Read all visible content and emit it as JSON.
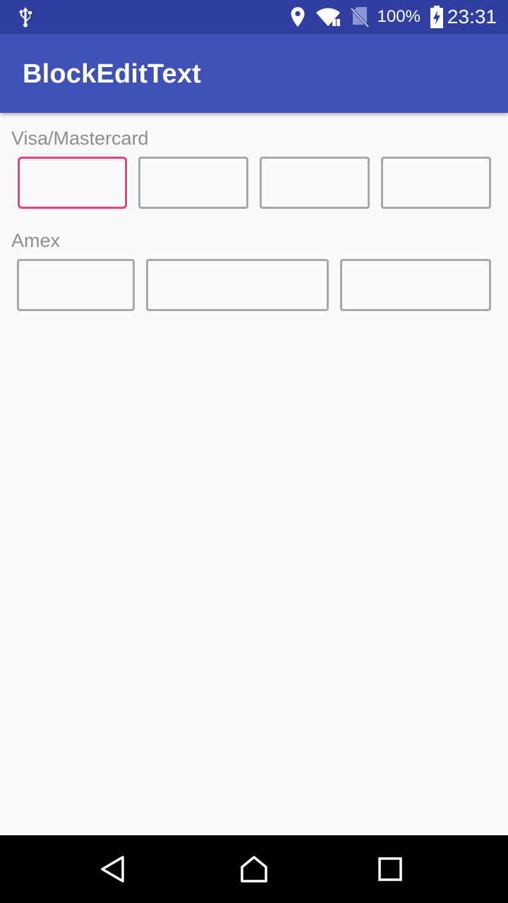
{
  "status_bar": {
    "icons": [
      "usb-icon",
      "location-icon",
      "wifi-icon",
      "no-sim-icon",
      "battery-charging-icon"
    ],
    "battery": "100%",
    "time": "23:31"
  },
  "app_bar": {
    "title": "BlockEditText"
  },
  "sections": [
    {
      "label": "Visa/Mastercard",
      "blocks": 4,
      "focused_block": 1
    },
    {
      "label": "Amex",
      "blocks": 3
    }
  ],
  "colors": {
    "status_bar": "#303f9f",
    "app_bar": "#3f51b5",
    "focus_accent": "#ec407a",
    "block_border": "#a7a7a7",
    "label": "#8e8e8e"
  },
  "nav_bar": {
    "icons": [
      "back-icon",
      "home-icon",
      "recents-icon"
    ]
  }
}
